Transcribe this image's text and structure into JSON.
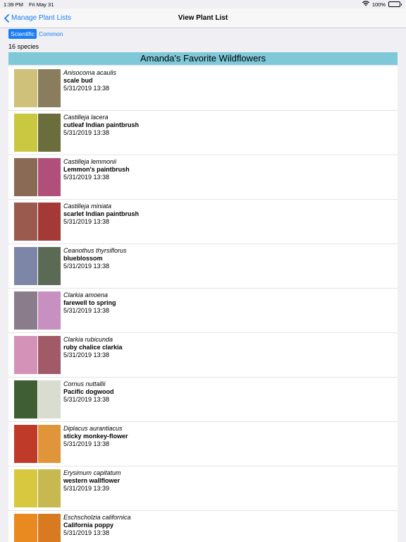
{
  "status": {
    "time": "1:39 PM",
    "date": "Fri May 31",
    "battery": "100%",
    "battery_level": 1.0
  },
  "nav": {
    "back_label": "Manage Plant Lists",
    "title": "View Plant List"
  },
  "toggle": {
    "options": [
      "Scientific",
      "Common"
    ],
    "selected": "Scientific"
  },
  "species_count": "16 species",
  "list_title": "Amanda's Favorite Wildflowers",
  "plants": [
    {
      "scientific": "Anisocoma acaulis",
      "common": "scale bud",
      "date": "5/31/2019 13:38",
      "colors": [
        "#cfc07a",
        "#8a7d5e"
      ]
    },
    {
      "scientific": "Castilleja lacera",
      "common": "cutleaf Indian paintbrush",
      "date": "5/31/2019 13:38",
      "colors": [
        "#c9c840",
        "#6b6e3c"
      ]
    },
    {
      "scientific": "Castilleja lemmonii",
      "common": "Lemmon's paintbrush",
      "date": "5/31/2019 13:38",
      "colors": [
        "#8b6a55",
        "#b0507a"
      ]
    },
    {
      "scientific": "Castilleja miniata",
      "common": "scarlet Indian paintbrush",
      "date": "5/31/2019 13:38",
      "colors": [
        "#9b5a4e",
        "#a33a35"
      ]
    },
    {
      "scientific": "Ceanothus thyrsiflorus",
      "common": "blueblossom",
      "date": "5/31/2019 13:38",
      "colors": [
        "#7d86a6",
        "#5a6a55"
      ]
    },
    {
      "scientific": "Clarkia amoena",
      "common": "farewell to spring",
      "date": "5/31/2019 13:38",
      "colors": [
        "#8a7c8a",
        "#c890c0"
      ]
    },
    {
      "scientific": "Clarkia rubicunda",
      "common": "ruby chalice clarkia",
      "date": "5/31/2019 13:38",
      "colors": [
        "#d592b8",
        "#a05a68"
      ]
    },
    {
      "scientific": "Cornus nuttallii",
      "common": "Pacific dogwood",
      "date": "5/31/2019 13:38",
      "colors": [
        "#3f5e33",
        "#d8ddd0"
      ]
    },
    {
      "scientific": "Diplacus aurantiacus",
      "common": "sticky monkey-flower",
      "date": "5/31/2019 13:38",
      "colors": [
        "#c03a2a",
        "#e0953a"
      ]
    },
    {
      "scientific": "Erysimum capitatum",
      "common": "western wallflower",
      "date": "5/31/2019 13:39",
      "colors": [
        "#d8c840",
        "#c8b850"
      ]
    },
    {
      "scientific": "Eschscholzia californica",
      "common": "California poppy",
      "date": "5/31/2019 13:38",
      "colors": [
        "#e88a20",
        "#d87a20"
      ]
    }
  ]
}
